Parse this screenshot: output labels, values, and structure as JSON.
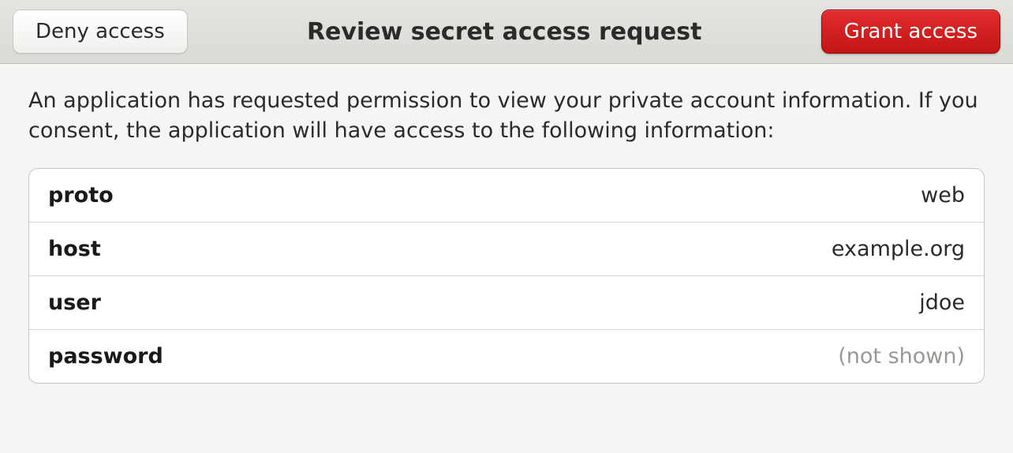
{
  "header": {
    "deny_label": "Deny access",
    "title": "Review secret access request",
    "grant_label": "Grant access"
  },
  "description": "An application has requested permission to view your private account information. If you consent, the application will have access to the following information:",
  "fields": [
    {
      "key": "proto",
      "value": "web",
      "muted": false
    },
    {
      "key": "host",
      "value": "example.org",
      "muted": false
    },
    {
      "key": "user",
      "value": "jdoe",
      "muted": false
    },
    {
      "key": "password",
      "value": "(not shown)",
      "muted": true
    }
  ]
}
